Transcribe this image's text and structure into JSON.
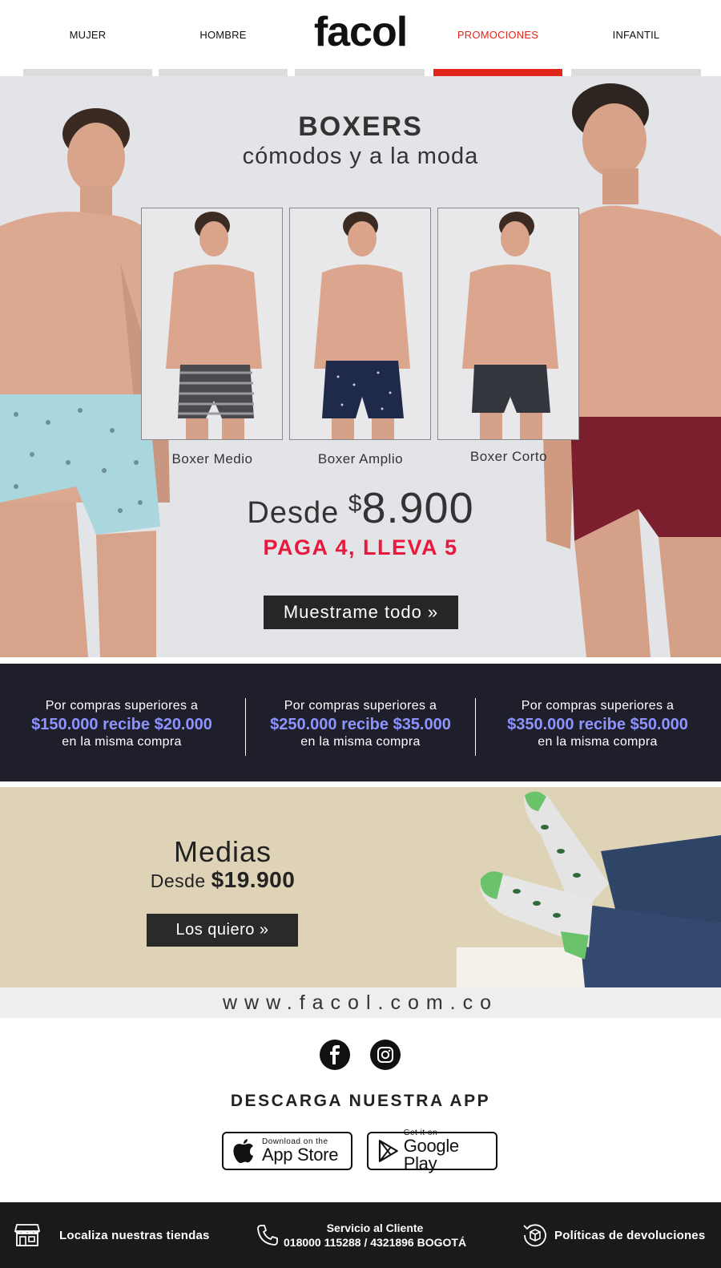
{
  "nav": {
    "items": [
      {
        "label": "MUJER",
        "active": false
      },
      {
        "label": "HOMBRE",
        "active": false
      },
      {
        "label": "PROMOCIONES",
        "active": true
      },
      {
        "label": "INFANTIL",
        "active": false
      }
    ],
    "logo": "facol"
  },
  "hero": {
    "title": "BOXERS",
    "subtitle": "cómodos y a la moda",
    "products": [
      {
        "label": "Boxer Medio"
      },
      {
        "label": "Boxer Amplio"
      },
      {
        "label": "Boxer Corto"
      }
    ],
    "price_prefix": "Desde ",
    "price_symbol": "$",
    "price_value": "8.900",
    "promo": "PAGA 4, LLEVA 5",
    "cta": "Muestrame todo »"
  },
  "offers": [
    {
      "line1": "Por compras superiores a",
      "line2": "$150.000 recibe $20.000",
      "line3": "en la misma compra"
    },
    {
      "line1": "Por compras superiores a",
      "line2": "$250.000 recibe $35.000",
      "line3": "en la misma compra"
    },
    {
      "line1": "Por compras superiores a",
      "line2": "$350.000 recibe $50.000",
      "line3": "en la misma compra"
    }
  ],
  "socks": {
    "title": "Medias",
    "price_prefix": "Desde ",
    "price": "$19.900",
    "cta": "Los quiero »"
  },
  "site_url": "www.facol.com.co",
  "app": {
    "title": "DESCARGA NUESTRA APP",
    "appstore_small": "Download on the",
    "appstore_big": "App Store",
    "googleplay_small": "Get it on",
    "googleplay_big": "Google Play"
  },
  "footer": {
    "stores": "Localiza nuestras tiendas",
    "service_title": "Servicio al Cliente",
    "service_phones": "018000 115288 / 4321896 BOGOTÁ",
    "returns": "Políticas de devoluciones"
  },
  "colors": {
    "accent_red": "#e1251b",
    "promo_pink": "#e8193c",
    "offer_blue": "#8d93ff",
    "dark_band": "#1f1f2c"
  }
}
